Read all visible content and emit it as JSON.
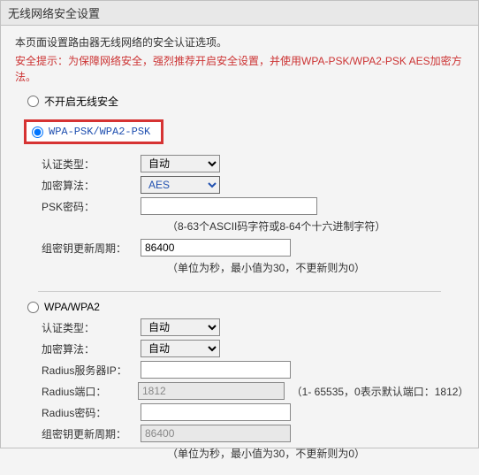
{
  "title": "无线网络安全设置",
  "intro": "本页面设置路由器无线网络的安全认证选项。",
  "warning": "安全提示：为保障网络安全，强烈推荐开启安全设置，并使用WPA-PSK/WPA2-PSK AES加密方法。",
  "radio_none": "不开启无线安全",
  "radio_psk": "WPA-PSK/WPA2-PSK",
  "radio_wpa": "WPA/WPA2",
  "psk": {
    "auth_label": "认证类型：",
    "auth_value": "自动",
    "algo_label": "加密算法：",
    "algo_value": "AES",
    "pwd_label": "PSK密码：",
    "pwd_value": "",
    "pwd_hint": "（8-63个ASCII码字符或8-64个十六进制字符）",
    "rekey_label": "组密钥更新周期：",
    "rekey_value": "86400",
    "rekey_hint": "（单位为秒，最小值为30，不更新则为0）"
  },
  "wpa": {
    "auth_label": "认证类型：",
    "auth_value": "自动",
    "algo_label": "加密算法：",
    "algo_value": "自动",
    "radius_ip_label": "Radius服务器IP：",
    "radius_ip_value": "",
    "radius_port_label": "Radius端口：",
    "radius_port_value": "1812",
    "radius_port_hint": "（1- 65535，0表示默认端口：1812）",
    "radius_pwd_label": "Radius密码：",
    "radius_pwd_value": "",
    "rekey_label": "组密钥更新周期：",
    "rekey_value": "86400",
    "rekey_hint": "（单位为秒，最小值为30，不更新则为0）"
  }
}
